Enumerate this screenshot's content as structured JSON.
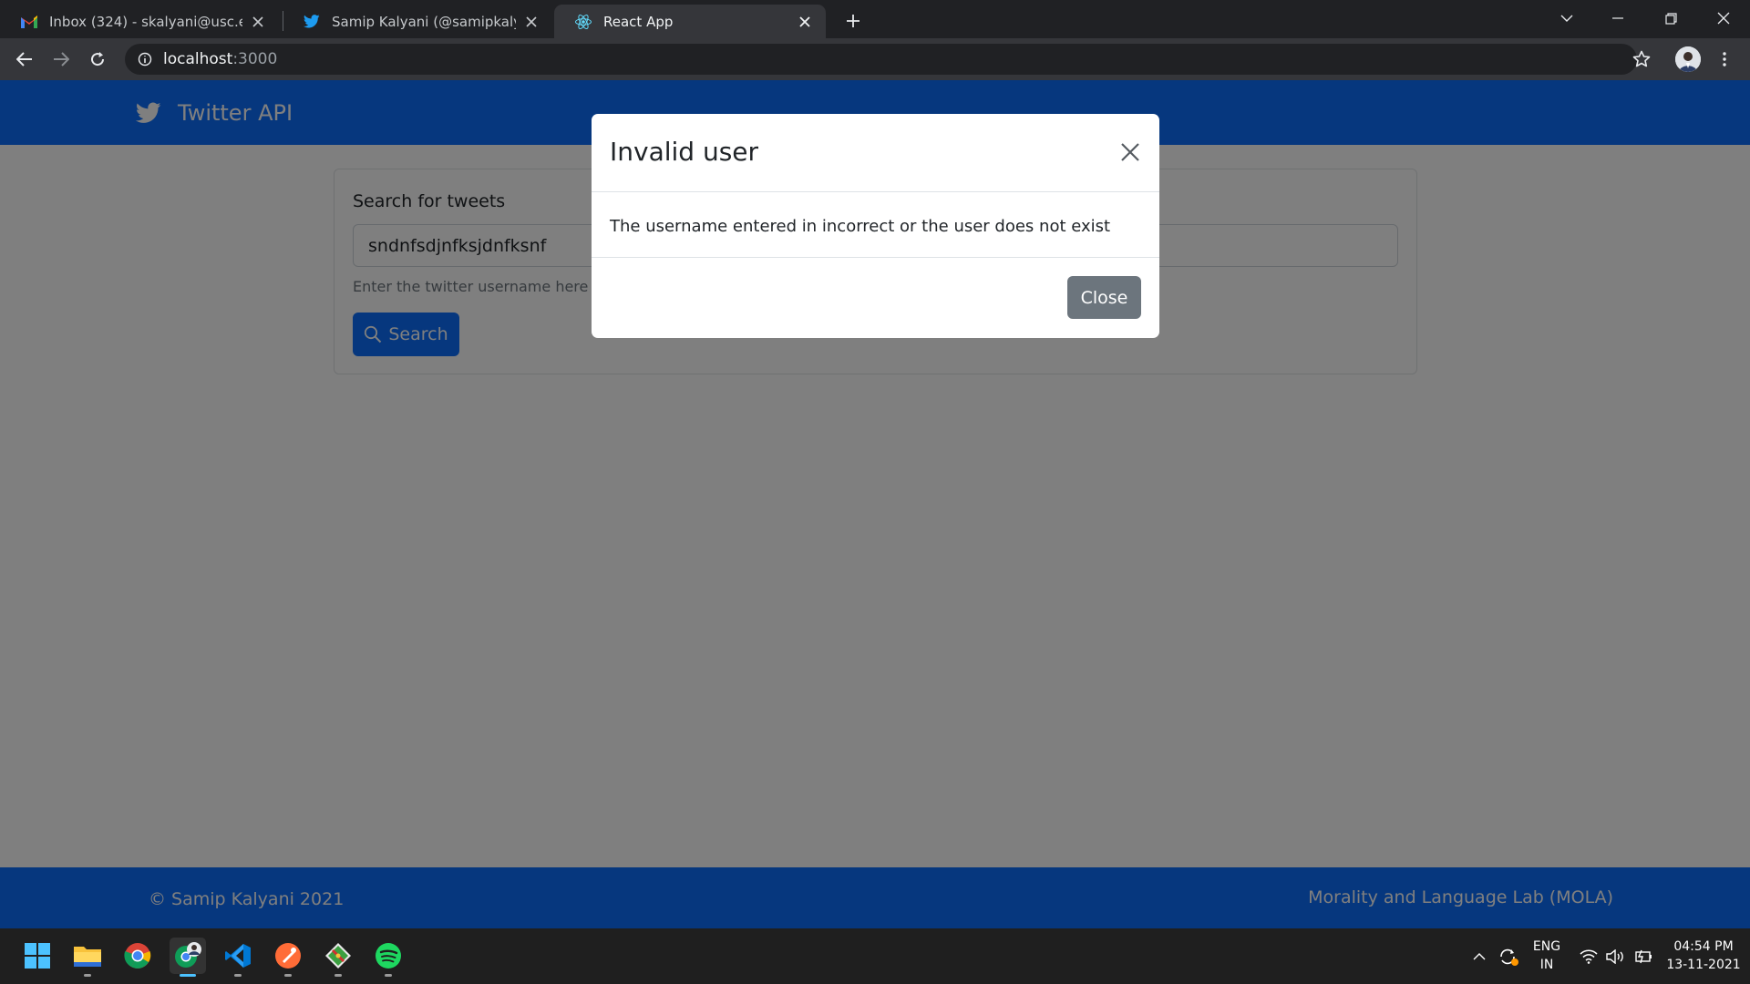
{
  "browser": {
    "tabs": [
      {
        "title": "Inbox (324) - skalyani@usc.edu -",
        "favicon": "gmail-icon"
      },
      {
        "title": "Samip Kalyani (@samipkalyani) /",
        "favicon": "twitter-icon"
      },
      {
        "title": "React App",
        "favicon": "react-icon"
      }
    ],
    "url_host": "localhost",
    "url_port": ":3000"
  },
  "app": {
    "brand": "Twitter API",
    "search": {
      "label": "Search for tweets",
      "value": "sndnfsdjnfksjdnfksnf",
      "hint": "Enter the twitter username here",
      "button_label": "Search"
    },
    "footer": {
      "copyright": "© Samip Kalyani 2021",
      "lab": "Morality and Language Lab (MOLA)"
    },
    "colors": {
      "primary": "#0d6efd",
      "secondary": "#6c757d"
    }
  },
  "modal": {
    "title": "Invalid user",
    "body": "The username entered in incorrect or the user does not exist",
    "close_label": "Close"
  },
  "taskbar": {
    "apps": [
      "windows-start-icon",
      "file-explorer-icon",
      "chrome-icon",
      "chrome-profile-icon",
      "vscode-icon",
      "postman-icon",
      "git-icon",
      "spotify-icon"
    ],
    "language_line1": "ENG",
    "language_line2": "IN",
    "time": "04:54 PM",
    "date": "13-11-2021"
  }
}
